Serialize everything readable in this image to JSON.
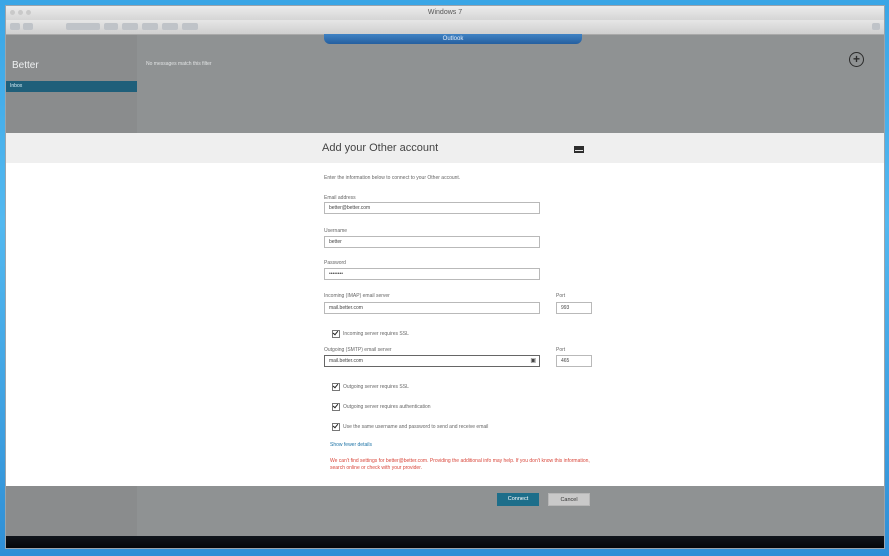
{
  "window": {
    "title": "Windows 7"
  },
  "app": {
    "title": "Better",
    "inbox_item": "Inbox",
    "empty_message": "No messages match this filter",
    "tab_label": "Outlook"
  },
  "flyout": {
    "title": "Add your Other account",
    "instructions": "Enter the information below to connect to your Other account.",
    "fields": {
      "email_label": "Email address",
      "email_value": "better@better.com",
      "username_label": "Username",
      "username_value": "better",
      "password_label": "Password",
      "password_value": "••••••••",
      "incoming_label": "Incoming (IMAP) email server",
      "incoming_value": "mail.better.com",
      "incoming_port_label": "Port",
      "incoming_port_value": "993",
      "incoming_ssl_label": "Incoming server requires SSL",
      "outgoing_label": "Outgoing (SMTP) email server",
      "outgoing_value": "mail.better.com",
      "outgoing_port_label": "Port",
      "outgoing_port_value": "465",
      "outgoing_ssl_label": "Outgoing server requires SSL",
      "outgoing_auth_label": "Outgoing server requires authentication",
      "same_creds_label": "Use the same username and password to send and receive email"
    },
    "show_fewer": "Show fewer details",
    "error": "We can't find settings for better@better.com. Providing the additional info may help. If you don't know this information, search online or check with your provider.",
    "buttons": {
      "connect": "Connect",
      "cancel": "Cancel"
    }
  }
}
